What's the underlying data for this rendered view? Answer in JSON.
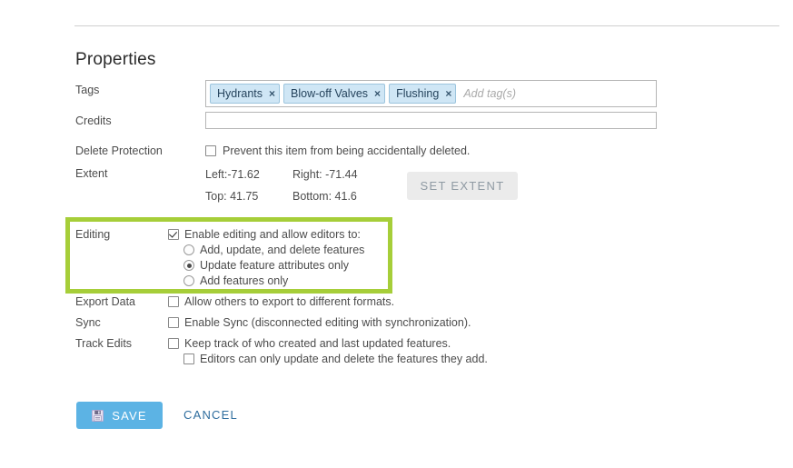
{
  "page": {
    "title": "Properties"
  },
  "tags": {
    "label": "Tags",
    "placeholder": "Add tag(s)",
    "remove_icon": "×",
    "items": [
      {
        "text": "Hydrants"
      },
      {
        "text": "Blow-off Valves"
      },
      {
        "text": "Flushing"
      }
    ]
  },
  "credits": {
    "label": "Credits",
    "value": "",
    "placeholder": ""
  },
  "delete_protection": {
    "label": "Delete Protection",
    "checkbox_label": "Prevent this item from being accidentally deleted.",
    "checked": false
  },
  "extent": {
    "label": "Extent",
    "left": "Left:-71.62",
    "right": "Right:  -71.44",
    "top": "Top:  41.75",
    "bottom": "Bottom:   41.6",
    "button_label": "SET EXTENT"
  },
  "editing": {
    "label": "Editing",
    "enable_label": "Enable editing and allow editors to:",
    "enabled": true,
    "highlight_color": "#a6ce39",
    "options": [
      {
        "label": "Add, update, and delete features",
        "selected": false
      },
      {
        "label": "Update feature attributes only",
        "selected": true
      },
      {
        "label": "Add features only",
        "selected": false
      }
    ]
  },
  "export_data": {
    "label": "Export Data",
    "checkbox_label": "Allow others to export to different formats.",
    "checked": false
  },
  "sync": {
    "label": "Sync",
    "checkbox_label": "Enable Sync (disconnected editing with synchronization).",
    "checked": false
  },
  "track_edits": {
    "label": "Track Edits",
    "checkbox_label": "Keep track of who created and last updated features.",
    "checked": false,
    "sub_checkbox_label": "Editors can only update and delete the features they add.",
    "sub_checked": false
  },
  "actions": {
    "save_label": "SAVE",
    "save_icon": "floppy-disk-icon",
    "save_color": "#5cb3e4",
    "cancel_label": "CANCEL",
    "cancel_color": "#2e6d9e"
  }
}
